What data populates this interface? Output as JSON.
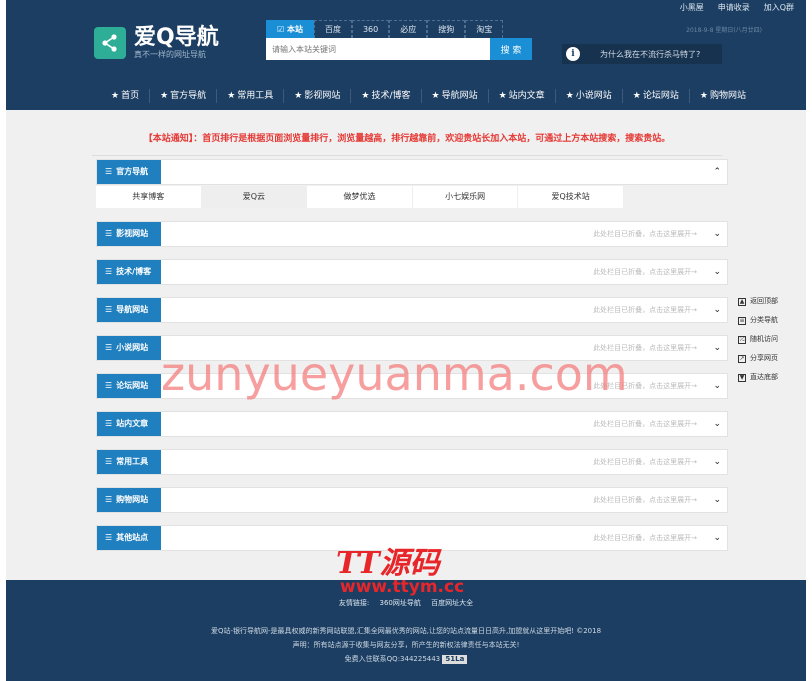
{
  "topbar": [
    "小黑屋",
    "申请收录",
    "加入Q群"
  ],
  "logo": {
    "title": "爱Q导航",
    "subtitle": "真不一样的网址导航"
  },
  "search": {
    "tabs": [
      "本站",
      "百度",
      "360",
      "必应",
      "搜狗",
      "淘宝"
    ],
    "placeholder": "请输入本站关键词",
    "button": "搜 索",
    "tip": "为什么我在不流行杀马特了?"
  },
  "date": "2018-9-8  星期日(八月廿四)",
  "nav": [
    "首页",
    "官方导航",
    "常用工具",
    "影视网站",
    "技术/博客",
    "导航网站",
    "站内文章",
    "小说网站",
    "论坛网站",
    "购物网站"
  ],
  "notice": "【本站通知】：首页排行是根据页面浏览量排行，浏览量越高，排行越靠前，欢迎贵站长加入本站，可通过上方本站搜索，搜索贵站。",
  "sections": [
    {
      "label": "官方导航",
      "hint": ""
    },
    {
      "label": "影视网站",
      "hint": "此处栏目已折叠，点击这里展开→"
    },
    {
      "label": "技术/博客",
      "hint": "此处栏目已折叠，点击这里展开→"
    },
    {
      "label": "导航网站",
      "hint": "此处栏目已折叠，点击这里展开→"
    },
    {
      "label": "小说网站",
      "hint": "此处栏目已折叠，点击这里展开→"
    },
    {
      "label": "论坛网站",
      "hint": "此处栏目已折叠，点击这里展开→"
    },
    {
      "label": "站内文章",
      "hint": "此处栏目已折叠，点击这里展开→"
    },
    {
      "label": "常用工具",
      "hint": "此处栏目已折叠，点击这里展开→"
    },
    {
      "label": "购物网站",
      "hint": "此处栏目已折叠，点击这里展开→"
    },
    {
      "label": "其他站点",
      "hint": "此处栏目已折叠，点击这里展开→"
    }
  ],
  "official_links": [
    "共享博客",
    "爱Q云",
    "做梦优选",
    "小七娱乐网",
    "爱Q技术站"
  ],
  "side_tools": [
    "返回顶部",
    "分类导航",
    "随机访问",
    "分享网页",
    "直达底部"
  ],
  "watermark": "zunyueyuanma.com",
  "watermark2": {
    "title": "TT源码",
    "url": "www.ttym.cc"
  },
  "footer": {
    "friends_label": "友情链接:",
    "friends": [
      "360网址导航",
      "百度网址大全"
    ],
    "copyright": "爱Q站-银行导航网-是最具权威的新秀网站联盟,汇集全网最优秀的网站,让您的站点流量日日高升,加盟就从这里开始吧! ©2018",
    "disclaimer": "声明：所有站点源于收集与网友分享，所产生的新权法律责任与本站无关!",
    "contact": "免费入住联系QQ:344225443",
    "badge": "51La"
  },
  "colors": {
    "header_bg": "#1c3e62",
    "accent": "#1f7fbf",
    "notice": "#e53935",
    "logo_icon": "#2fae97"
  }
}
